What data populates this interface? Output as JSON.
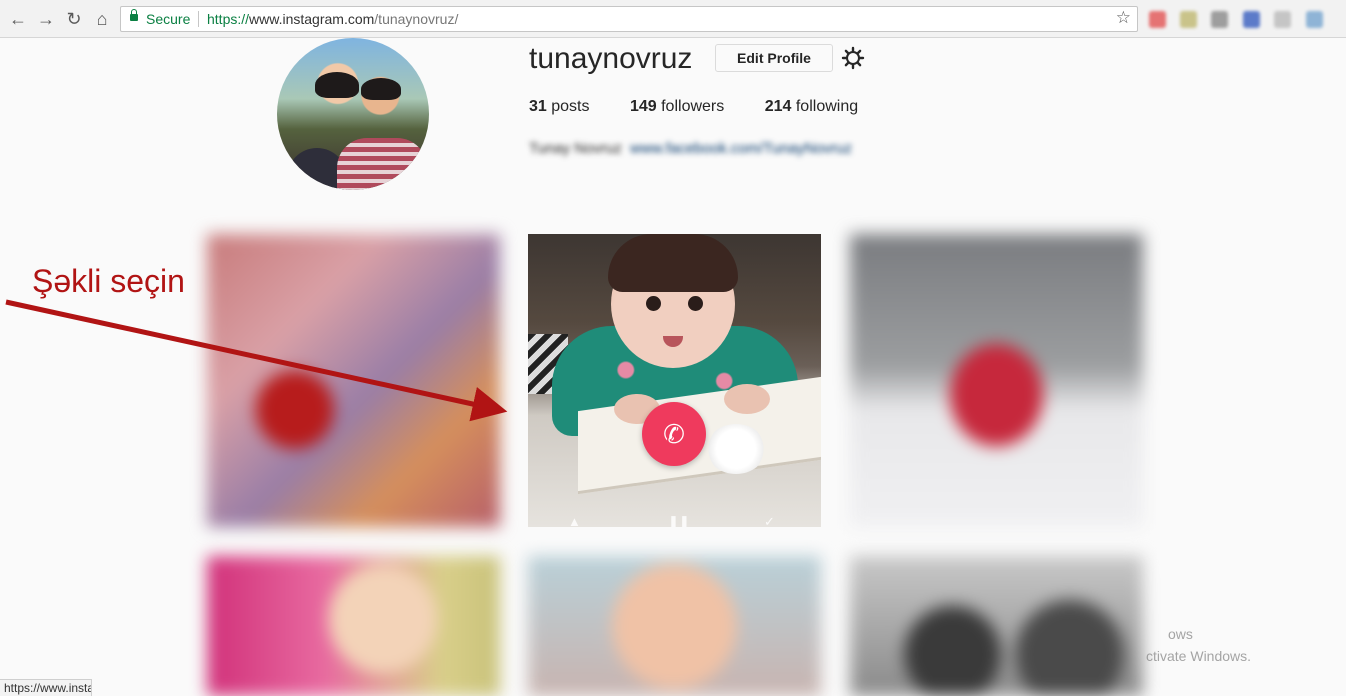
{
  "browser": {
    "secure_label": "Secure",
    "url_protocol": "https://",
    "url_domain": "www.instagram.com",
    "url_path": "/tunaynovruz/",
    "status_url": "https://www.insta"
  },
  "profile": {
    "username": "tunaynovruz",
    "edit_button": "Edit Profile",
    "posts_count": "31",
    "posts_label": "posts",
    "followers_count": "149",
    "followers_label": "followers",
    "following_count": "214",
    "following_label": "following",
    "bio_name": "Tunay Novruz",
    "bio_link": "www.facebook.com/TunayNovruz"
  },
  "annotation": {
    "text": "Şəkli seçin",
    "color": "#b11414"
  },
  "watermark": {
    "line1": "ows",
    "line2": "ctivate Windows."
  },
  "colors": {
    "secure_green": "#0b8043",
    "call_button": "#ef3a5d",
    "annotation_red": "#b11414"
  }
}
